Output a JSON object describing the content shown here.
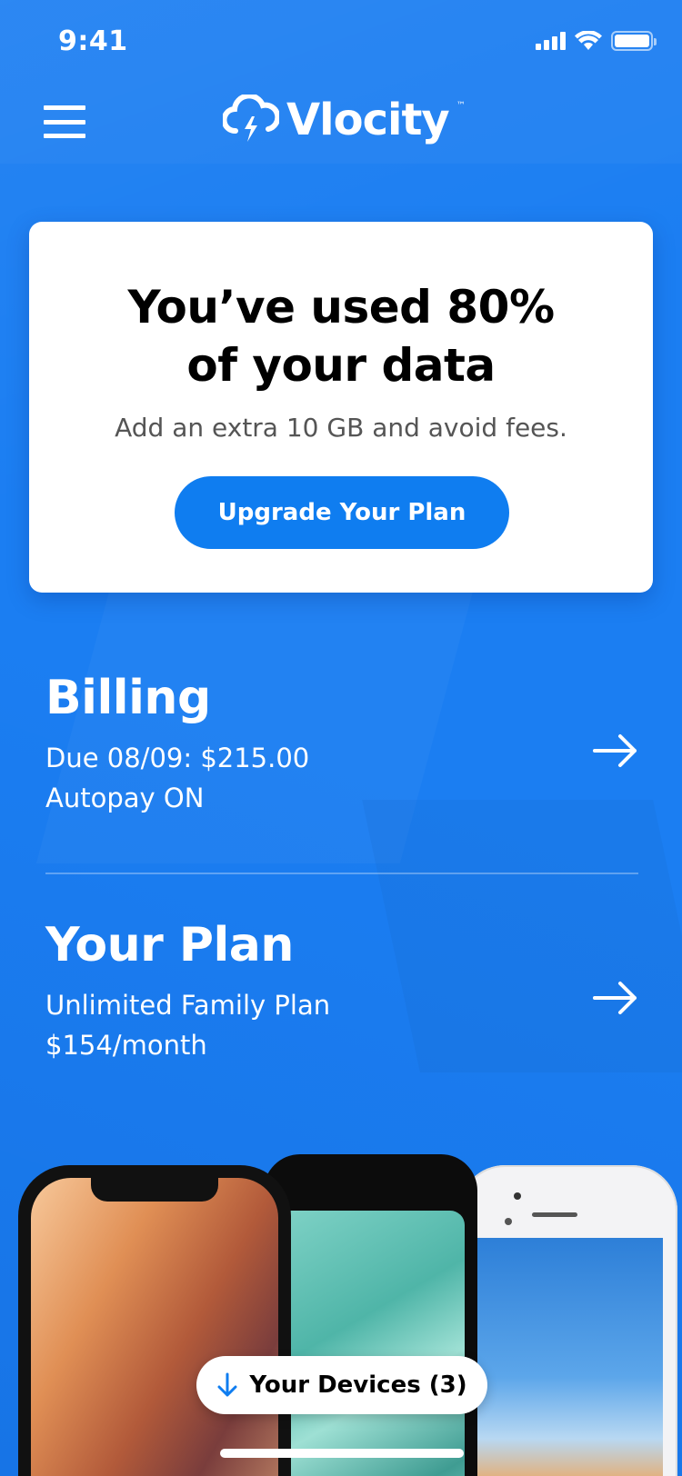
{
  "status_bar": {
    "time": "9:41"
  },
  "header": {
    "brand": "Vlocity",
    "trademark": "™"
  },
  "promo": {
    "title_line1": "You’ve used 80%",
    "title_line2": "of your data",
    "subtitle": "Add an extra 10 GB and avoid fees.",
    "button_label": "Upgrade Your Plan"
  },
  "billing": {
    "title": "Billing",
    "line1": "Due 08/09: $215.00",
    "line2": "Autopay ON"
  },
  "plan": {
    "title": "Your Plan",
    "line1": "Unlimited Family Plan",
    "line2": "$154/month"
  },
  "devices": {
    "label": "Your Devices (3)"
  },
  "colors": {
    "background": "#1b7ef2",
    "accent": "#0f7df0",
    "card": "#ffffff"
  }
}
